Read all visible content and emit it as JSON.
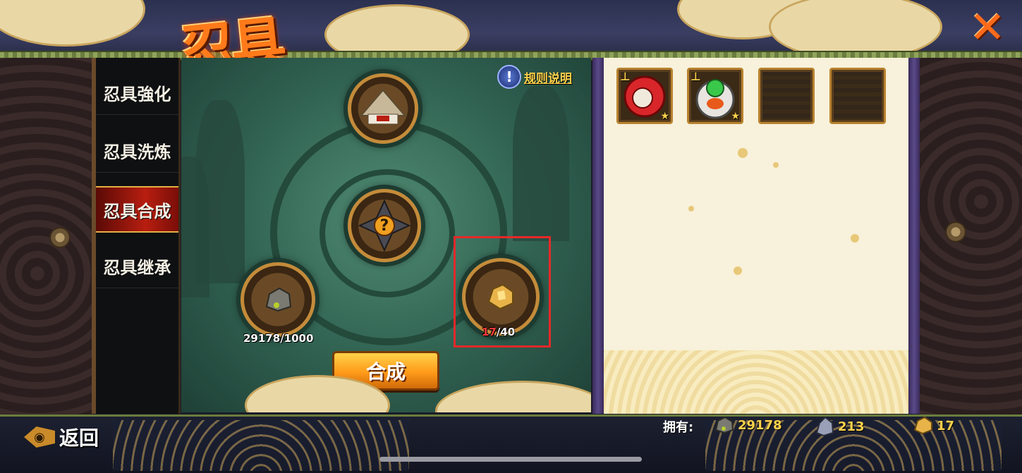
{
  "header": {
    "title": "忍具",
    "close_icon": "close-x-icon"
  },
  "menu": {
    "items": [
      {
        "label": "忍具強化",
        "active": false
      },
      {
        "label": "忍具洗炼",
        "active": false
      },
      {
        "label": "忍具合成",
        "active": true
      },
      {
        "label": "忍具继承",
        "active": false
      }
    ]
  },
  "synthesis": {
    "rules_label": "规则说明",
    "rules_icon": "info-icon",
    "target_item_icon": "straw-hat-icon",
    "result_icon": "question-shuriken-icon",
    "material_left": {
      "icon": "stone-ore-icon",
      "have": "29178",
      "need": "1000"
    },
    "material_right": {
      "icon": "gold-ore-icon",
      "have": "17",
      "need": "40"
    },
    "synthesize_button": "合成"
  },
  "inventory": {
    "slots": [
      {
        "icon": "red-scroll-item-icon",
        "filled": true
      },
      {
        "icon": "green-gem-ring-icon",
        "filled": true
      },
      {
        "filled": false
      },
      {
        "filled": false
      }
    ]
  },
  "footer": {
    "back_label": "返回",
    "owned_label": "拥有:",
    "resources": [
      {
        "icon": "stone-ore-icon",
        "value": "29178"
      },
      {
        "icon": "crystal-ore-icon",
        "value": "213"
      },
      {
        "icon": "gold-ore-icon",
        "value": "17"
      }
    ]
  },
  "colors": {
    "accent_orange": "#ff9a1a",
    "highlight_red": "#e82828",
    "active_tab_red": "#b81e10",
    "gold_text": "#ffd24a"
  }
}
